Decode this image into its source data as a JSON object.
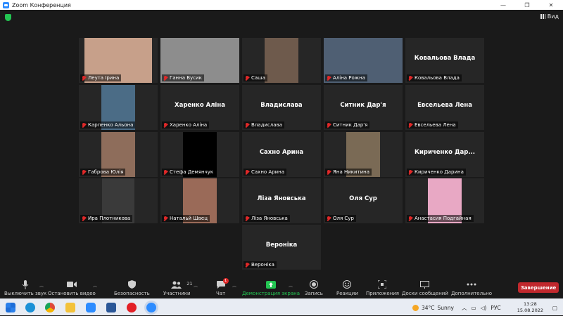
{
  "window": {
    "title": "Zoom Конференция",
    "view_label": "Вид"
  },
  "participants": [
    {
      "name": "Леута Ірина",
      "display": "",
      "video": true,
      "photo_color": "#c7a08a"
    },
    {
      "name": "Ганна Вусик",
      "display": "",
      "video": true,
      "photo_color": "#8d8d8d"
    },
    {
      "name": "Саша",
      "display": "",
      "video": true,
      "photo_color": "#6e5a4c"
    },
    {
      "name": "Аліна Рожна",
      "display": "",
      "video": true,
      "photo_color": "#4f5f73"
    },
    {
      "name": "Ковальова Влада",
      "display": "Ковальова Влада",
      "video": false
    },
    {
      "name": "Карпенко Альона",
      "display": "",
      "video": true,
      "photo_color": "#4b6c86"
    },
    {
      "name": "Харенко Аліна",
      "display": "Харенко Аліна",
      "video": false
    },
    {
      "name": "Владислава",
      "display": "Владислава",
      "video": false
    },
    {
      "name": "Ситник Дар'я",
      "display": "Ситник Дар'я",
      "video": false
    },
    {
      "name": "Евсельева Лена",
      "display": "Евсельева Лена",
      "video": false
    },
    {
      "name": "Габрова Юлія",
      "display": "",
      "video": true,
      "photo_color": "#8e6d5b"
    },
    {
      "name": "Стефа Демянчук",
      "display": "",
      "video": true,
      "photo_color": "#000000"
    },
    {
      "name": "Сахно Арина",
      "display": "Сахно Арина",
      "video": false
    },
    {
      "name": "Яна Никитина",
      "display": "",
      "video": true,
      "photo_color": "#7a6a55"
    },
    {
      "name": "Кириченко Дарина",
      "display": "Кириченко  Дар...",
      "video": false
    },
    {
      "name": "Ира Плотникова",
      "display": "",
      "video": true,
      "photo_color": "#3a3a3a"
    },
    {
      "name": "Натальй Швец",
      "display": "",
      "video": true,
      "photo_color": "#9a6a58"
    },
    {
      "name": "Ліза Яновська",
      "display": "Ліза Яновська",
      "video": false
    },
    {
      "name": "Оля Сур",
      "display": "Оля Сур",
      "video": false
    },
    {
      "name": "Анастасия Подгайная",
      "display": "",
      "video": true,
      "photo_color": "#e8a8c4"
    },
    {
      "name": "Вероніка",
      "display": "Вероніка",
      "video": false
    }
  ],
  "toolbar": {
    "mute": "Выключить звук",
    "video": "Остановить видео",
    "security": "Безопасность",
    "participants": "Участники",
    "participants_count": "21",
    "chat": "Чат",
    "chat_badge": "1",
    "share": "Демонстрация экрана",
    "record": "Запись",
    "reactions": "Реакции",
    "apps": "Приложения",
    "whiteboards": "Доски сообщений",
    "more": "Дополнительно",
    "end": "Завершение"
  },
  "taskbar": {
    "weather_temp": "34°C",
    "weather_text": "Sunny",
    "lang": "РУС",
    "time": "13:28",
    "date": "15.08.2022"
  }
}
